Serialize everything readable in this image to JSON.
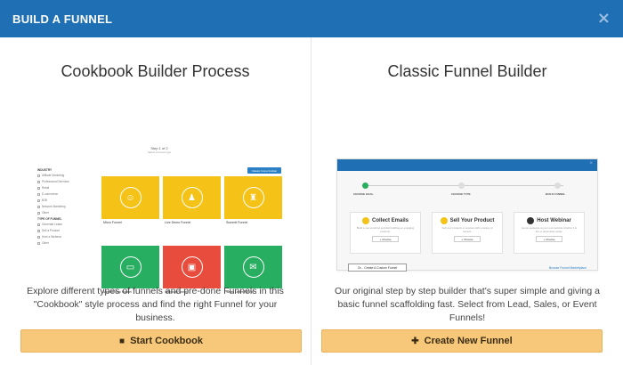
{
  "modal": {
    "title": "BUILD A FUNNEL",
    "close_icon": "×"
  },
  "cookbook": {
    "title": "Cookbook Builder Process",
    "description": "Explore different types of funnels and pre-done Funnels in this \"Cookbook\" style process and find the right Funnel for your business.",
    "cta_label": "Start Cookbook",
    "cta_icon": "book-icon",
    "preview": {
      "step_label": "Step 1 of 2",
      "step_sub": "Select a funnel type",
      "classic_button": "Classic funnel builder",
      "industry_label": "INDUSTRY",
      "type_label": "TYPE OF FUNNEL",
      "industries": [
        "Affiliate Marketing",
        "Professional Services",
        "Retail",
        "E-commerce",
        "B2B",
        "Network Marketing",
        "Other"
      ],
      "types": [
        "Generate Leads",
        "Sell a Product",
        "Host a Webinar",
        "Other"
      ],
      "cards": [
        {
          "label": "Micro Funnel",
          "color": "yellow",
          "icon": "person-icon"
        },
        {
          "label": "Live Demo Funnel",
          "color": "yellow",
          "icon": "presenter-icon"
        },
        {
          "label": "Summit Funnel",
          "color": "yellow",
          "icon": "group-icon"
        },
        {
          "label": "Membership Funnel",
          "color": "green",
          "icon": "membership-icon"
        },
        {
          "label": "Webinar Funnel",
          "color": "red",
          "icon": "webinar-icon"
        },
        {
          "label": "Sales Letter Funnel",
          "color": "green",
          "icon": "letter-icon"
        }
      ]
    }
  },
  "classic": {
    "title": "Classic Funnel Builder",
    "description": "Our original step by step builder that's super simple and giving a basic funnel scaffolding fast. Select from Lead, Sales, or Event Funnels!",
    "cta_label": "Create New Funnel",
    "cta_icon": "plus-icon",
    "preview": {
      "steps": [
        "CHOOSE GOAL",
        "CHOOSE TYPE",
        "BUILD FUNNEL"
      ],
      "goals": [
        {
          "title": "Collect Emails",
          "text": "Build a new email list and start building an engaging email list.",
          "button": "+ Choose"
        },
        {
          "title": "Sell Your Product",
          "text": "Sell your products or services with a variety of funnels.",
          "button": "+ Choose"
        },
        {
          "title": "Host Webinar",
          "text": "Get an audience at your next webinar whether it is live or automated replay.",
          "button": "+ Choose"
        }
      ],
      "custom_button": "Or... Create A Custom Funnel",
      "marketplace_link": "Browse Funnel Marketplace"
    }
  },
  "colors": {
    "header": "#1f6fb5",
    "cta": "#f7c77a",
    "yellow": "#f5c218",
    "green": "#27ae60",
    "red": "#e74c3c"
  }
}
